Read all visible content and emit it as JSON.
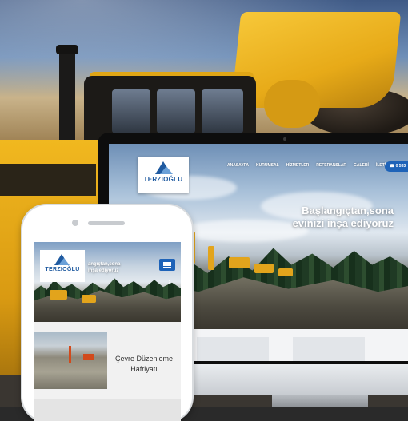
{
  "desktop_site": {
    "logo_text": "TERZIOĞLU",
    "nav": [
      "ANASAYFA",
      "KURUMSAL",
      "HİZMETLER",
      "REFERANSLAR",
      "GALERİ",
      "İLETİŞİM"
    ],
    "phone_label": "0 533",
    "hero_title_line1": "Başlangıçtan,sona",
    "hero_title_line2": "evinizi inşa ediyoruz"
  },
  "mobile_site": {
    "logo_text": "TERZIOĞLU",
    "hero_text_line1": "angıçtan,sona",
    "hero_text_line2": "inşa ediyoruz",
    "next_arrow": "›",
    "card_title_line1": "Çevre Düzenleme",
    "card_title_line2": "Hafriyatı"
  },
  "colors": {
    "brand_blue": "#1f5aa0",
    "accent_blue": "#1e63b8",
    "loader_yellow": "#f1b81f"
  },
  "icons": {
    "menu": "hamburger-icon",
    "next": "chevron-right-icon"
  }
}
